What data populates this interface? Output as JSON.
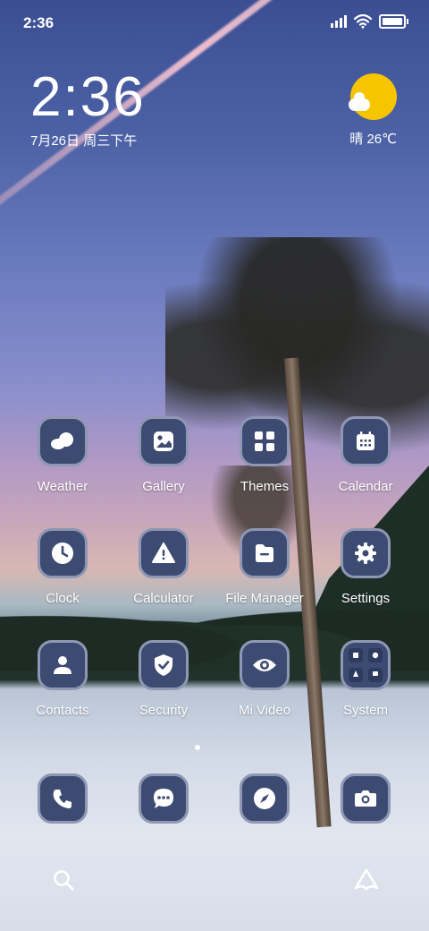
{
  "status_bar": {
    "time": "2:36",
    "battery_level": 1.0,
    "signal_bars": 4
  },
  "clock_widget": {
    "time": "2:36",
    "date": "7月26日 周三下午"
  },
  "weather_widget": {
    "text": "晴 26℃",
    "icon": "sun-cloud-icon"
  },
  "apps": [
    {
      "label": "Weather",
      "icon": "weather-icon"
    },
    {
      "label": "Gallery",
      "icon": "gallery-icon"
    },
    {
      "label": "Themes",
      "icon": "themes-icon"
    },
    {
      "label": "Calendar",
      "icon": "calendar-icon"
    },
    {
      "label": "Clock",
      "icon": "clock-icon"
    },
    {
      "label": "Calculator",
      "icon": "calculator-icon"
    },
    {
      "label": "File Manager",
      "icon": "file-manager-icon"
    },
    {
      "label": "Settings",
      "icon": "settings-icon"
    },
    {
      "label": "Contacts",
      "icon": "contacts-icon"
    },
    {
      "label": "Security",
      "icon": "security-icon"
    },
    {
      "label": "Mi Video",
      "icon": "mi-video-icon"
    },
    {
      "label": "System",
      "icon": "system-folder-icon"
    }
  ],
  "dock": [
    {
      "icon": "phone-icon"
    },
    {
      "icon": "messages-icon"
    },
    {
      "icon": "browser-icon"
    },
    {
      "icon": "camera-icon"
    }
  ],
  "bottom_bar": [
    {
      "icon": "search-icon"
    },
    {
      "icon": "assistant-icon"
    }
  ],
  "colors": {
    "icon_background": "#3d4a72",
    "icon_border": "#8e97b3",
    "sun": "#f6c500"
  }
}
